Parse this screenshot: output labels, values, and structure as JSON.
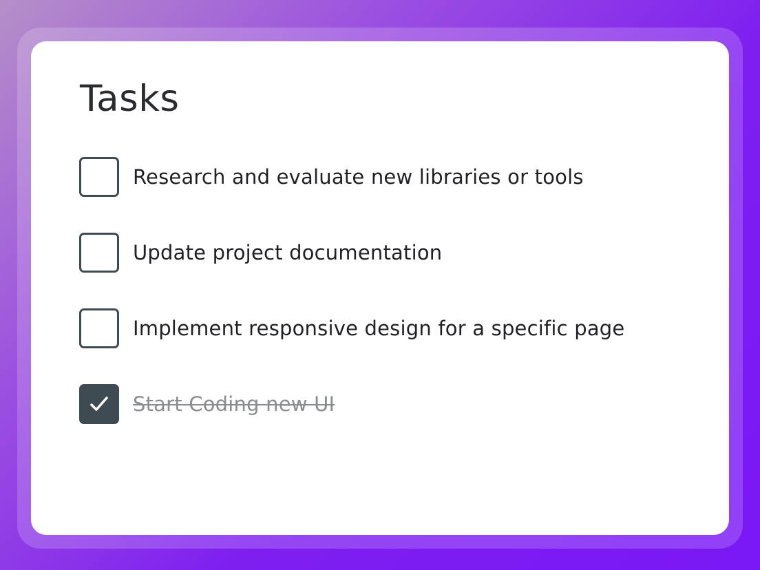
{
  "title": "Tasks",
  "tasks": [
    {
      "label": "Research and evaluate new libraries or tools",
      "checked": false
    },
    {
      "label": "Update project documentation",
      "checked": false
    },
    {
      "label": "Implement responsive design for a specific page",
      "checked": false
    },
    {
      "label": "Start Coding new UI",
      "checked": true
    }
  ],
  "colors": {
    "checkbox": "#3e4b52",
    "done_text": "#8a8d90",
    "background_start": "#b58fc8",
    "background_end": "#7a17f5"
  },
  "icons": {
    "check": "check-icon"
  }
}
